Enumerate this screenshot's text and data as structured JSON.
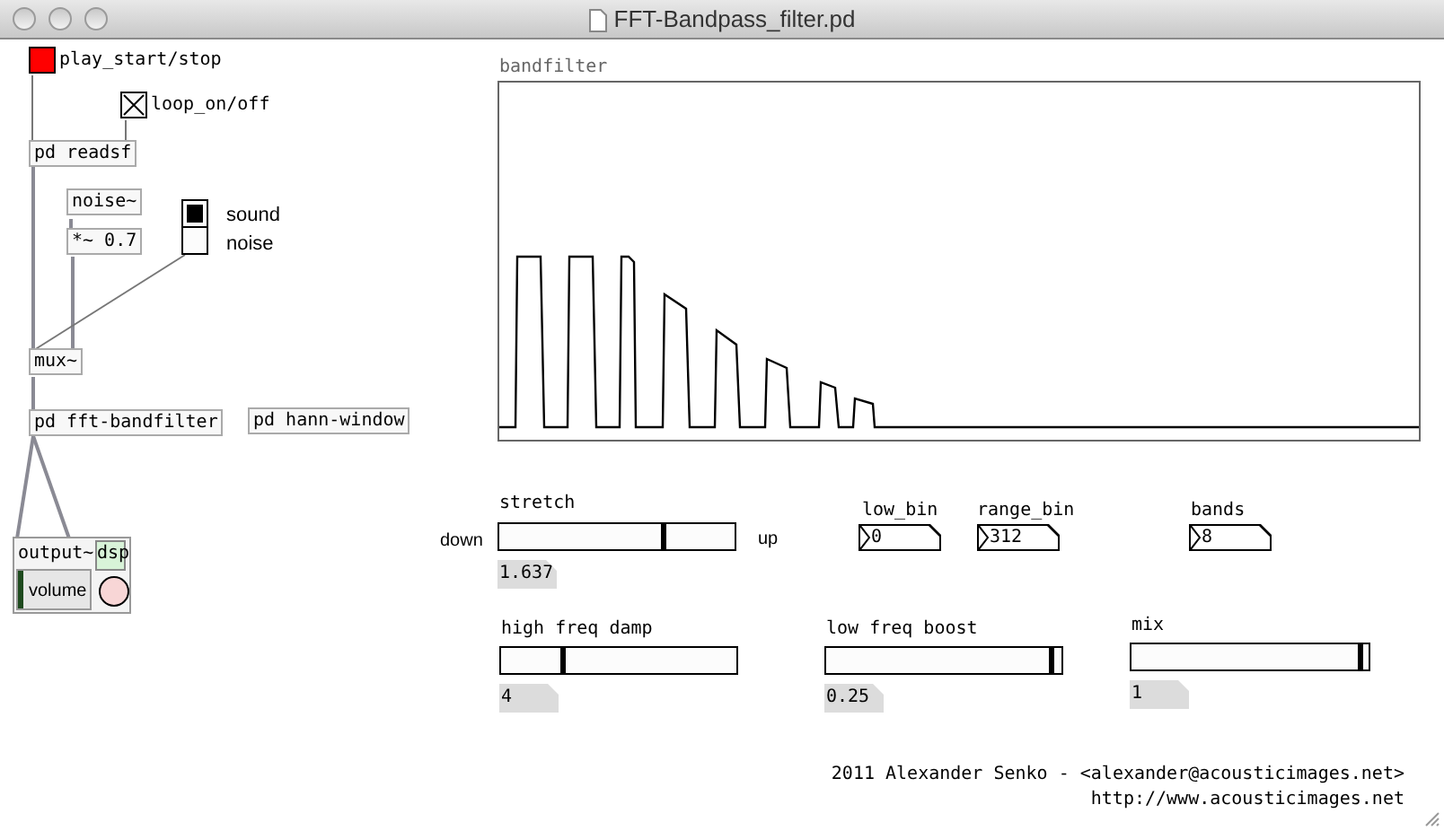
{
  "window": {
    "title": "FFT-Bandpass_filter.pd"
  },
  "bang": {
    "label": "play_start/stop",
    "on": true
  },
  "toggle": {
    "label": "loop_on/off",
    "checked": true
  },
  "objects": [
    "pd readsf",
    "noise~",
    "*~ 0.7",
    "mux~",
    "pd fft-bandfilter",
    "pd hann-window"
  ],
  "radio": {
    "options": [
      {
        "label": "sound",
        "selected": true
      },
      {
        "label": "noise",
        "selected": false
      }
    ]
  },
  "output": {
    "title": "output~",
    "dsp": "dsp",
    "volume_label": "volume",
    "level": 0.04
  },
  "array": {
    "name": "bandfilter"
  },
  "sliders": [
    {
      "label": "stretch",
      "level": 0.7,
      "value": "1.637",
      "left": "down",
      "right": "up"
    },
    {
      "label": "high freq damp",
      "level": 0.26,
      "value": "4"
    },
    {
      "label": "low freq boost",
      "level": 0.97,
      "value": "0.25"
    },
    {
      "label": "mix",
      "level": 0.98,
      "value": "1"
    }
  ],
  "number_boxes": [
    {
      "label": "low_bin",
      "value": "0"
    },
    {
      "label": "range_bin",
      "value": "312"
    },
    {
      "label": "bands",
      "value": "8"
    }
  ],
  "credits": [
    "2011 Alexander Senko - <alexander@acousticimages.net>",
    "http://www.acousticimages.net"
  ]
}
